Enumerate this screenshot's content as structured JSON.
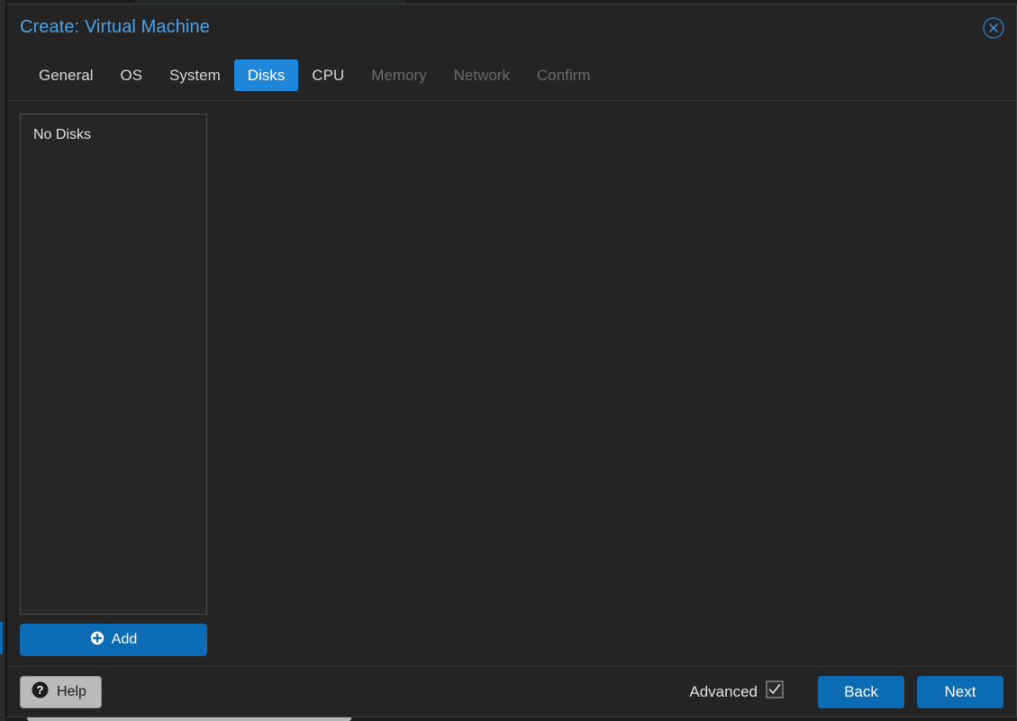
{
  "dialog": {
    "title": "Create: Virtual Machine",
    "close_icon": "close-circle-icon"
  },
  "tabs": [
    {
      "label": "General",
      "state": "enabled"
    },
    {
      "label": "OS",
      "state": "enabled"
    },
    {
      "label": "System",
      "state": "enabled"
    },
    {
      "label": "Disks",
      "state": "active"
    },
    {
      "label": "CPU",
      "state": "enabled"
    },
    {
      "label": "Memory",
      "state": "disabled"
    },
    {
      "label": "Network",
      "state": "disabled"
    },
    {
      "label": "Confirm",
      "state": "disabled"
    }
  ],
  "disks": {
    "empty_text": "No Disks",
    "items": [],
    "add_label": "Add",
    "add_icon": "plus-circle-icon"
  },
  "footer": {
    "help_label": "Help",
    "help_icon": "question-circle-icon",
    "advanced_label": "Advanced",
    "advanced_checked": true,
    "back_label": "Back",
    "next_label": "Next"
  },
  "colors": {
    "window_bg": "#242424",
    "accent_blue": "#1f87d9",
    "button_blue": "#0b6cb5",
    "title_blue": "#4aa3e8",
    "text": "#e2e2e2",
    "text_disabled": "#6a6a6a",
    "border": "#3b3b3b",
    "panel_border": "#4a4a4a",
    "help_bg": "#bababa"
  }
}
